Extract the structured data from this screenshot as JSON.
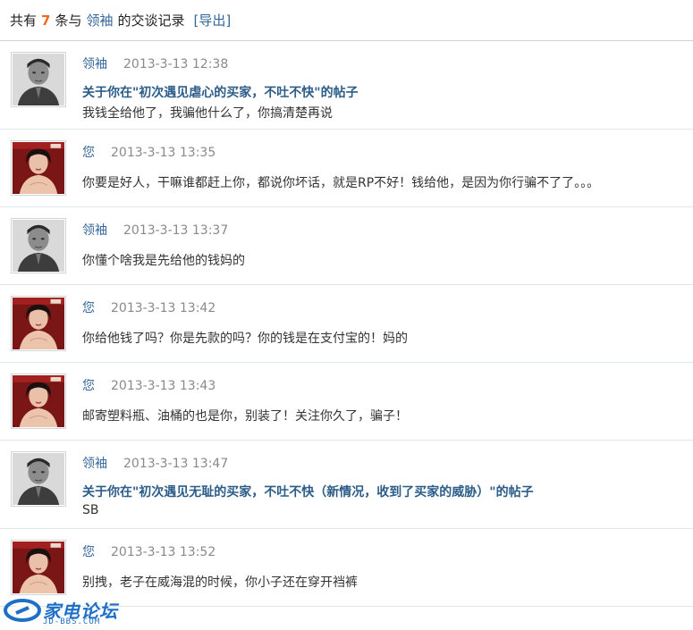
{
  "header": {
    "prefix": "共有",
    "count": "7",
    "middle": "条与",
    "partner": "领袖",
    "suffix": "的交谈记录",
    "export_label": "[导出]"
  },
  "messages": [
    {
      "author": "领袖",
      "time": "2013-3-13 12:38",
      "avatar": "man-portrait",
      "thread_title": "关于你在\"初次遇见虐心的买家，不吐不快\"的帖子",
      "text": "我钱全给他了，我骗他什么了，你搞清楚再说"
    },
    {
      "author": "您",
      "time": "2013-3-13 13:35",
      "avatar": "woman-portrait",
      "thread_title": "",
      "text": "你要是好人，干嘛谁都赶上你，都说你坏话，就是RP不好！钱给他，是因为你行骗不了了。。。"
    },
    {
      "author": "领袖",
      "time": "2013-3-13 13:37",
      "avatar": "man-portrait",
      "thread_title": "",
      "text": "你懂个啥我是先给他的钱妈的"
    },
    {
      "author": "您",
      "time": "2013-3-13 13:42",
      "avatar": "woman-portrait",
      "thread_title": "",
      "text": "你给他钱了吗？你是先款的吗？你的钱是在支付宝的！妈的"
    },
    {
      "author": "您",
      "time": "2013-3-13 13:43",
      "avatar": "woman-portrait",
      "thread_title": "",
      "text": "邮寄塑料瓶、油桶的也是你，别装了！关注你久了，骗子！"
    },
    {
      "author": "领袖",
      "time": "2013-3-13 13:47",
      "avatar": "man-portrait",
      "thread_title": "关于你在\"初次遇见无耻的买家，不吐不快（新情况，收到了买家的威胁）\"的帖子",
      "text": "SB"
    },
    {
      "author": "您",
      "time": "2013-3-13 13:52",
      "avatar": "woman-portrait",
      "thread_title": "",
      "text": "别拽，老子在威海混的时候，你小子还在穿开裆裤"
    }
  ],
  "watermark": {
    "name": "家电论坛",
    "domain": "JD-BBS.COM"
  }
}
